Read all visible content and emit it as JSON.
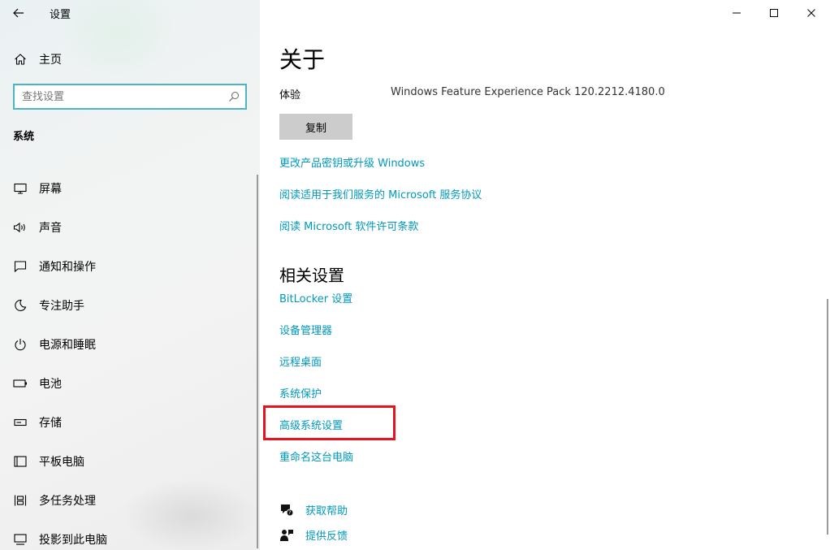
{
  "window": {
    "title": "设置"
  },
  "sidebar": {
    "home_label": "主页",
    "search_placeholder": "查找设置",
    "section_label": "系统",
    "items": [
      {
        "label": "屏幕",
        "icon": "display-icon"
      },
      {
        "label": "声音",
        "icon": "speaker-icon"
      },
      {
        "label": "通知和操作",
        "icon": "notification-icon"
      },
      {
        "label": "专注助手",
        "icon": "moon-icon"
      },
      {
        "label": "电源和睡眠",
        "icon": "power-icon"
      },
      {
        "label": "电池",
        "icon": "battery-icon"
      },
      {
        "label": "存储",
        "icon": "storage-icon"
      },
      {
        "label": "平板电脑",
        "icon": "tablet-icon"
      },
      {
        "label": "多任务处理",
        "icon": "multitasking-icon"
      },
      {
        "label": "投影到此电脑",
        "icon": "project-icon"
      }
    ]
  },
  "main": {
    "page_title": "关于",
    "spec_label": "体验",
    "spec_value": "Windows Feature Experience Pack 120.2212.4180.0",
    "copy_button": "复制",
    "links": [
      "更改产品密钥或升级 Windows",
      "阅读适用于我们服务的 Microsoft 服务协议",
      "阅读 Microsoft 软件许可条款"
    ],
    "related_title": "相关设置",
    "related_links": [
      "BitLocker 设置",
      "设备管理器",
      "远程桌面",
      "系统保护",
      "高级系统设置",
      "重命名这台电脑"
    ],
    "help_label": "获取帮助",
    "feedback_label": "提供反馈"
  },
  "colors": {
    "link": "#0099bc",
    "search_border": "#4fb3c7",
    "highlight": "#e5141e",
    "copy_button_bg": "#cccccc"
  }
}
